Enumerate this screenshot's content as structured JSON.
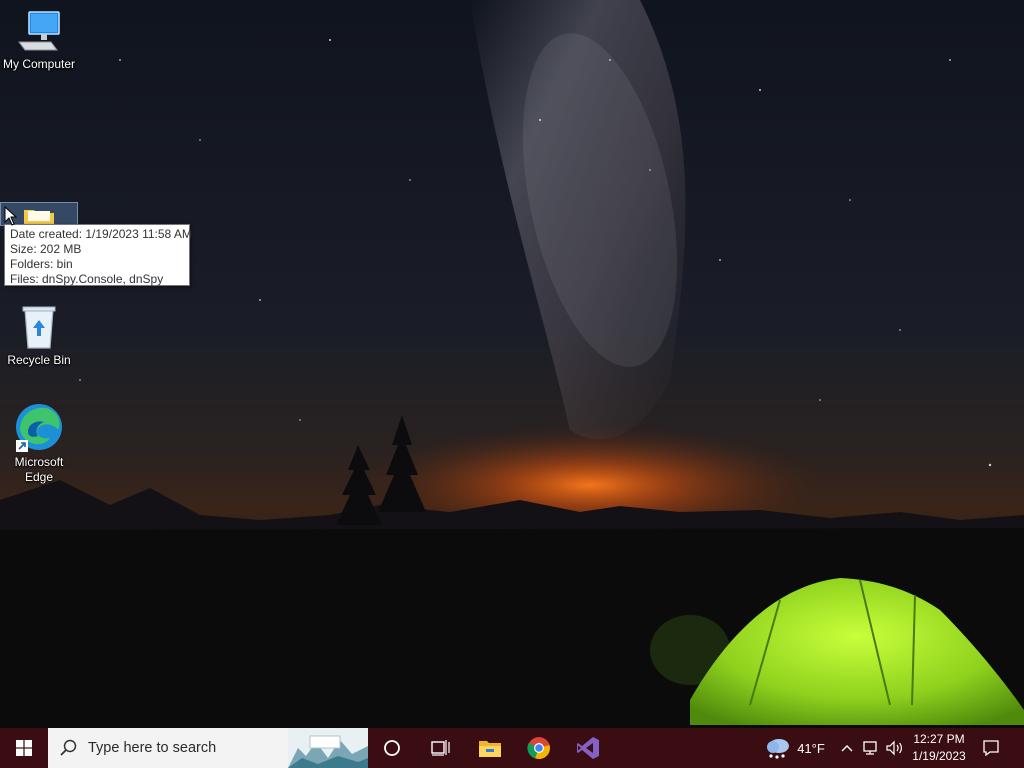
{
  "desktop": {
    "icons": [
      {
        "label": "My Computer"
      },
      {
        "label": "Recycle Bin"
      },
      {
        "label": "Microsoft Edge"
      }
    ],
    "tooltip": {
      "line1": "Date created: 1/19/2023 11:58 AM",
      "line2": "Size: 202 MB",
      "line3": "Folders: bin",
      "line4": "Files: dnSpy.Console, dnSpy"
    }
  },
  "taskbar": {
    "search_placeholder": "Type here to search",
    "weather_temp": "41°F",
    "clock_time": "12:27 PM",
    "clock_date": "1/19/2023",
    "pinned": [
      "cortana-icon",
      "task-view-icon",
      "file-explorer-icon",
      "chrome-icon",
      "visual-studio-icon"
    ],
    "colors": {
      "taskbar": "#3a0d12",
      "search_bg": "#f3f3f3"
    }
  }
}
